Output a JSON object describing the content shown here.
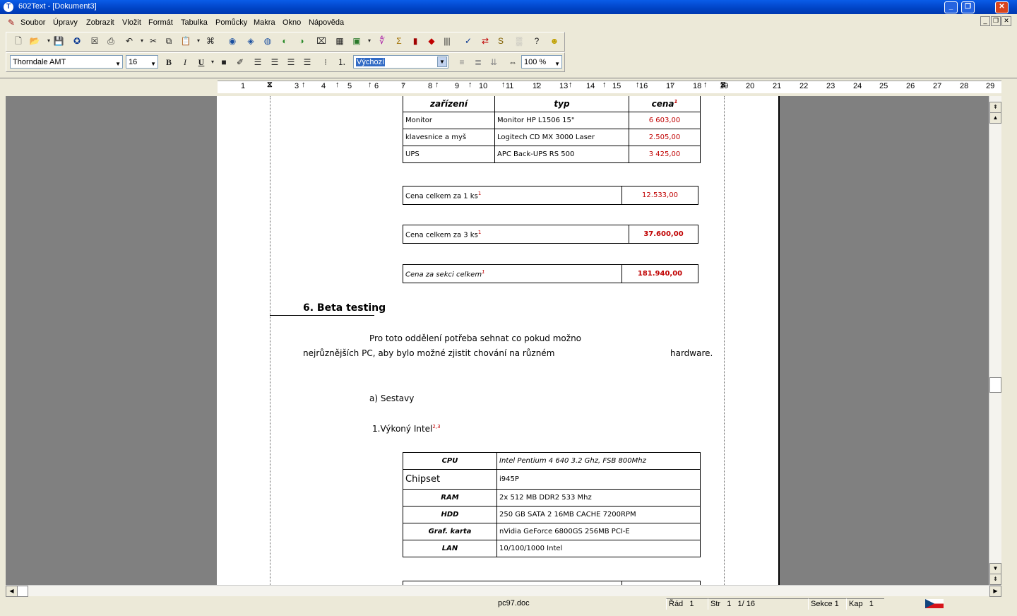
{
  "window": {
    "title": "602Text - [Dokument3]",
    "app_icon_letter": "T"
  },
  "menu": [
    "Soubor",
    "Úpravy",
    "Zobrazit",
    "Vložit",
    "Formát",
    "Tabulka",
    "Pomůcky",
    "Makra",
    "Okno",
    "Nápověda"
  ],
  "format_bar": {
    "font": "Thorndale AMT",
    "size": "16",
    "style": "Výchozí",
    "zoom": "100 %",
    "bold": "B",
    "italic": "I",
    "underline": "U"
  },
  "ruler": {
    "numbers": [
      "1",
      "3",
      "4",
      "5",
      "6",
      "7",
      "8",
      "9",
      "10",
      "11",
      "12",
      "13",
      "14",
      "15",
      "16",
      "17",
      "18",
      "19",
      "20",
      "21",
      "22",
      "23",
      "24",
      "25",
      "26",
      "27",
      "28",
      "29"
    ]
  },
  "doc": {
    "device_table": {
      "headers": [
        "zařízení",
        "typ",
        "cena"
      ],
      "rows": [
        {
          "device": "Monitor",
          "type": "Monitor HP L1506 15\"",
          "price": "6 603,00"
        },
        {
          "device": "klavesnice a myš",
          "type": "Logitech CD MX 3000 Laser",
          "price": "2.505,00"
        },
        {
          "device": "UPS",
          "type": "APC Back-UPS RS 500",
          "price": "3 425,00"
        }
      ]
    },
    "total1": {
      "label": "Cena celkem za 1 ks",
      "value": "12.533,00"
    },
    "total3": {
      "label": "Cena celkem za 3 ks",
      "value": "37.600,00"
    },
    "total_section": {
      "label": "Cena za sekci celkem",
      "value": "181.940,00"
    },
    "footnote_mark": "1",
    "section_heading": "6. Beta testing",
    "para1_line1": "Pro toto oddělení potřeba sehnat co pokud možno",
    "para1_line2": "nejrůznějších PC, aby bylo možné zjistit chování na různém",
    "para1_end": "hardware.",
    "sub_a": "a) Sestavy",
    "item1": "1.Výkoný Intel",
    "item1_mark": "2,3",
    "spec_table": [
      {
        "label": "CPU",
        "value": "Intel Pentium 4 640 3.2 Ghz,  FSB 800Mhz"
      },
      {
        "label": "Chipset",
        "value": "i945P"
      },
      {
        "label": "RAM",
        "value": "2x 512 MB DDR2 533 Mhz"
      },
      {
        "label": "HDD",
        "value": "250 GB SATA 2 16MB CACHE 7200RPM"
      },
      {
        "label": "Graf. karta",
        "value": "nVidia GeForce 6800GS 256MB PCI-E"
      },
      {
        "label": "LAN",
        "value": "10/100/1000 Intel"
      }
    ]
  },
  "status": {
    "file": "pc97.doc",
    "row_label": "Řád",
    "row": "1",
    "page_label": "Str",
    "page": "1",
    "page_total": "1/  16",
    "section": "Sekce 1",
    "chapter_label": "Kap",
    "chapter": "1"
  }
}
